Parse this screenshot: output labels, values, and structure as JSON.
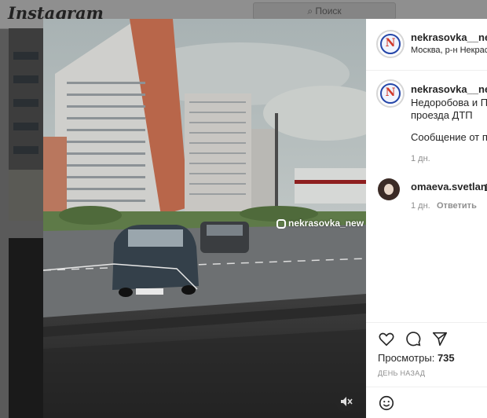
{
  "app": {
    "logo": "Instagram",
    "search_placeholder": "Поиск"
  },
  "post": {
    "username": "nekrasovka__new",
    "location": "Москва, р-н Некрасо",
    "watermark": "nekrasovka_new",
    "caption_lines": [
      "Недоробова и Пр",
      "проезда ДТП"
    ],
    "caption_more": "Сообщение от по",
    "caption_time": "1 дн.",
    "views_label": "Просмотры:",
    "views_count": "735",
    "posted_ago": "ДЕНЬ НАЗАД"
  },
  "comment": {
    "username": "omaeva.svetlana",
    "trailing": "1",
    "time": "1 дн.",
    "reply_label": "Ответить"
  },
  "avatar_letter": "N",
  "icons": [
    "search-icon",
    "heart-icon",
    "comment-icon",
    "share-icon",
    "emoji-icon",
    "mute-icon",
    "instagram-glyph-icon"
  ],
  "colors": {
    "accent_blue": "#2546a8",
    "logo_red": "#d23a2b",
    "meta_gray": "#8e8e8e"
  }
}
